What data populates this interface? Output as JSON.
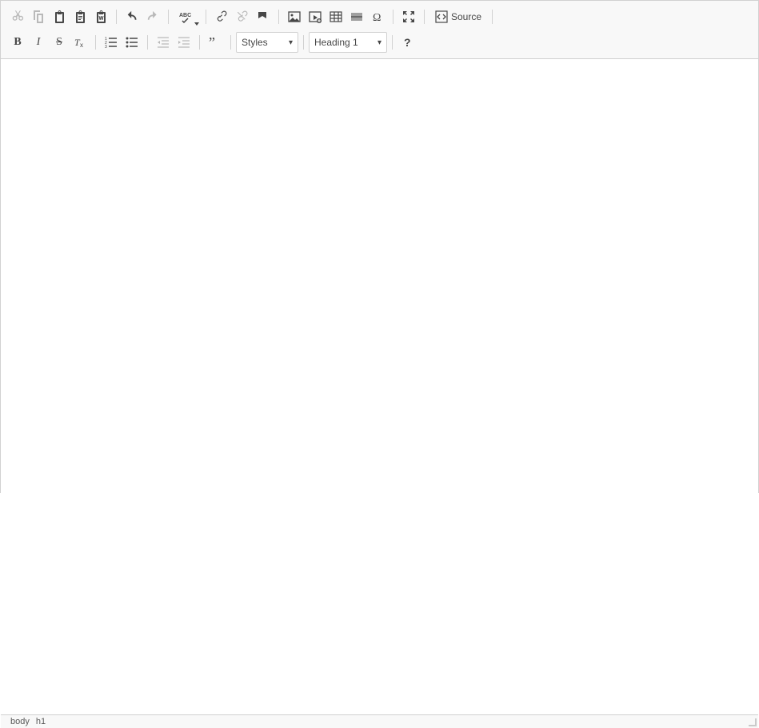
{
  "toolbar": {
    "source_label": "Source",
    "styles_label": "Styles",
    "format_label": "Heading 1",
    "bold_char": "B",
    "italic_char": "I",
    "strike_char": "S"
  },
  "statusbar": {
    "path": [
      "body",
      "h1"
    ]
  },
  "icons": {
    "cut": "cut",
    "copy": "copy",
    "paste": "paste",
    "paste_text": "paste-text",
    "paste_word": "paste-word",
    "undo": "undo",
    "redo": "redo",
    "spellcheck": "spellcheck",
    "link": "link",
    "unlink": "unlink",
    "anchor": "anchor",
    "image": "image",
    "embed": "embed",
    "table": "table",
    "hr": "hr",
    "specialchar": "specialchar",
    "maximize": "maximize",
    "source": "source",
    "removeformat": "removeformat",
    "numlist": "numlist",
    "bullist": "bullist",
    "outdent": "outdent",
    "indent": "indent",
    "blockquote": "blockquote",
    "about": "about"
  }
}
